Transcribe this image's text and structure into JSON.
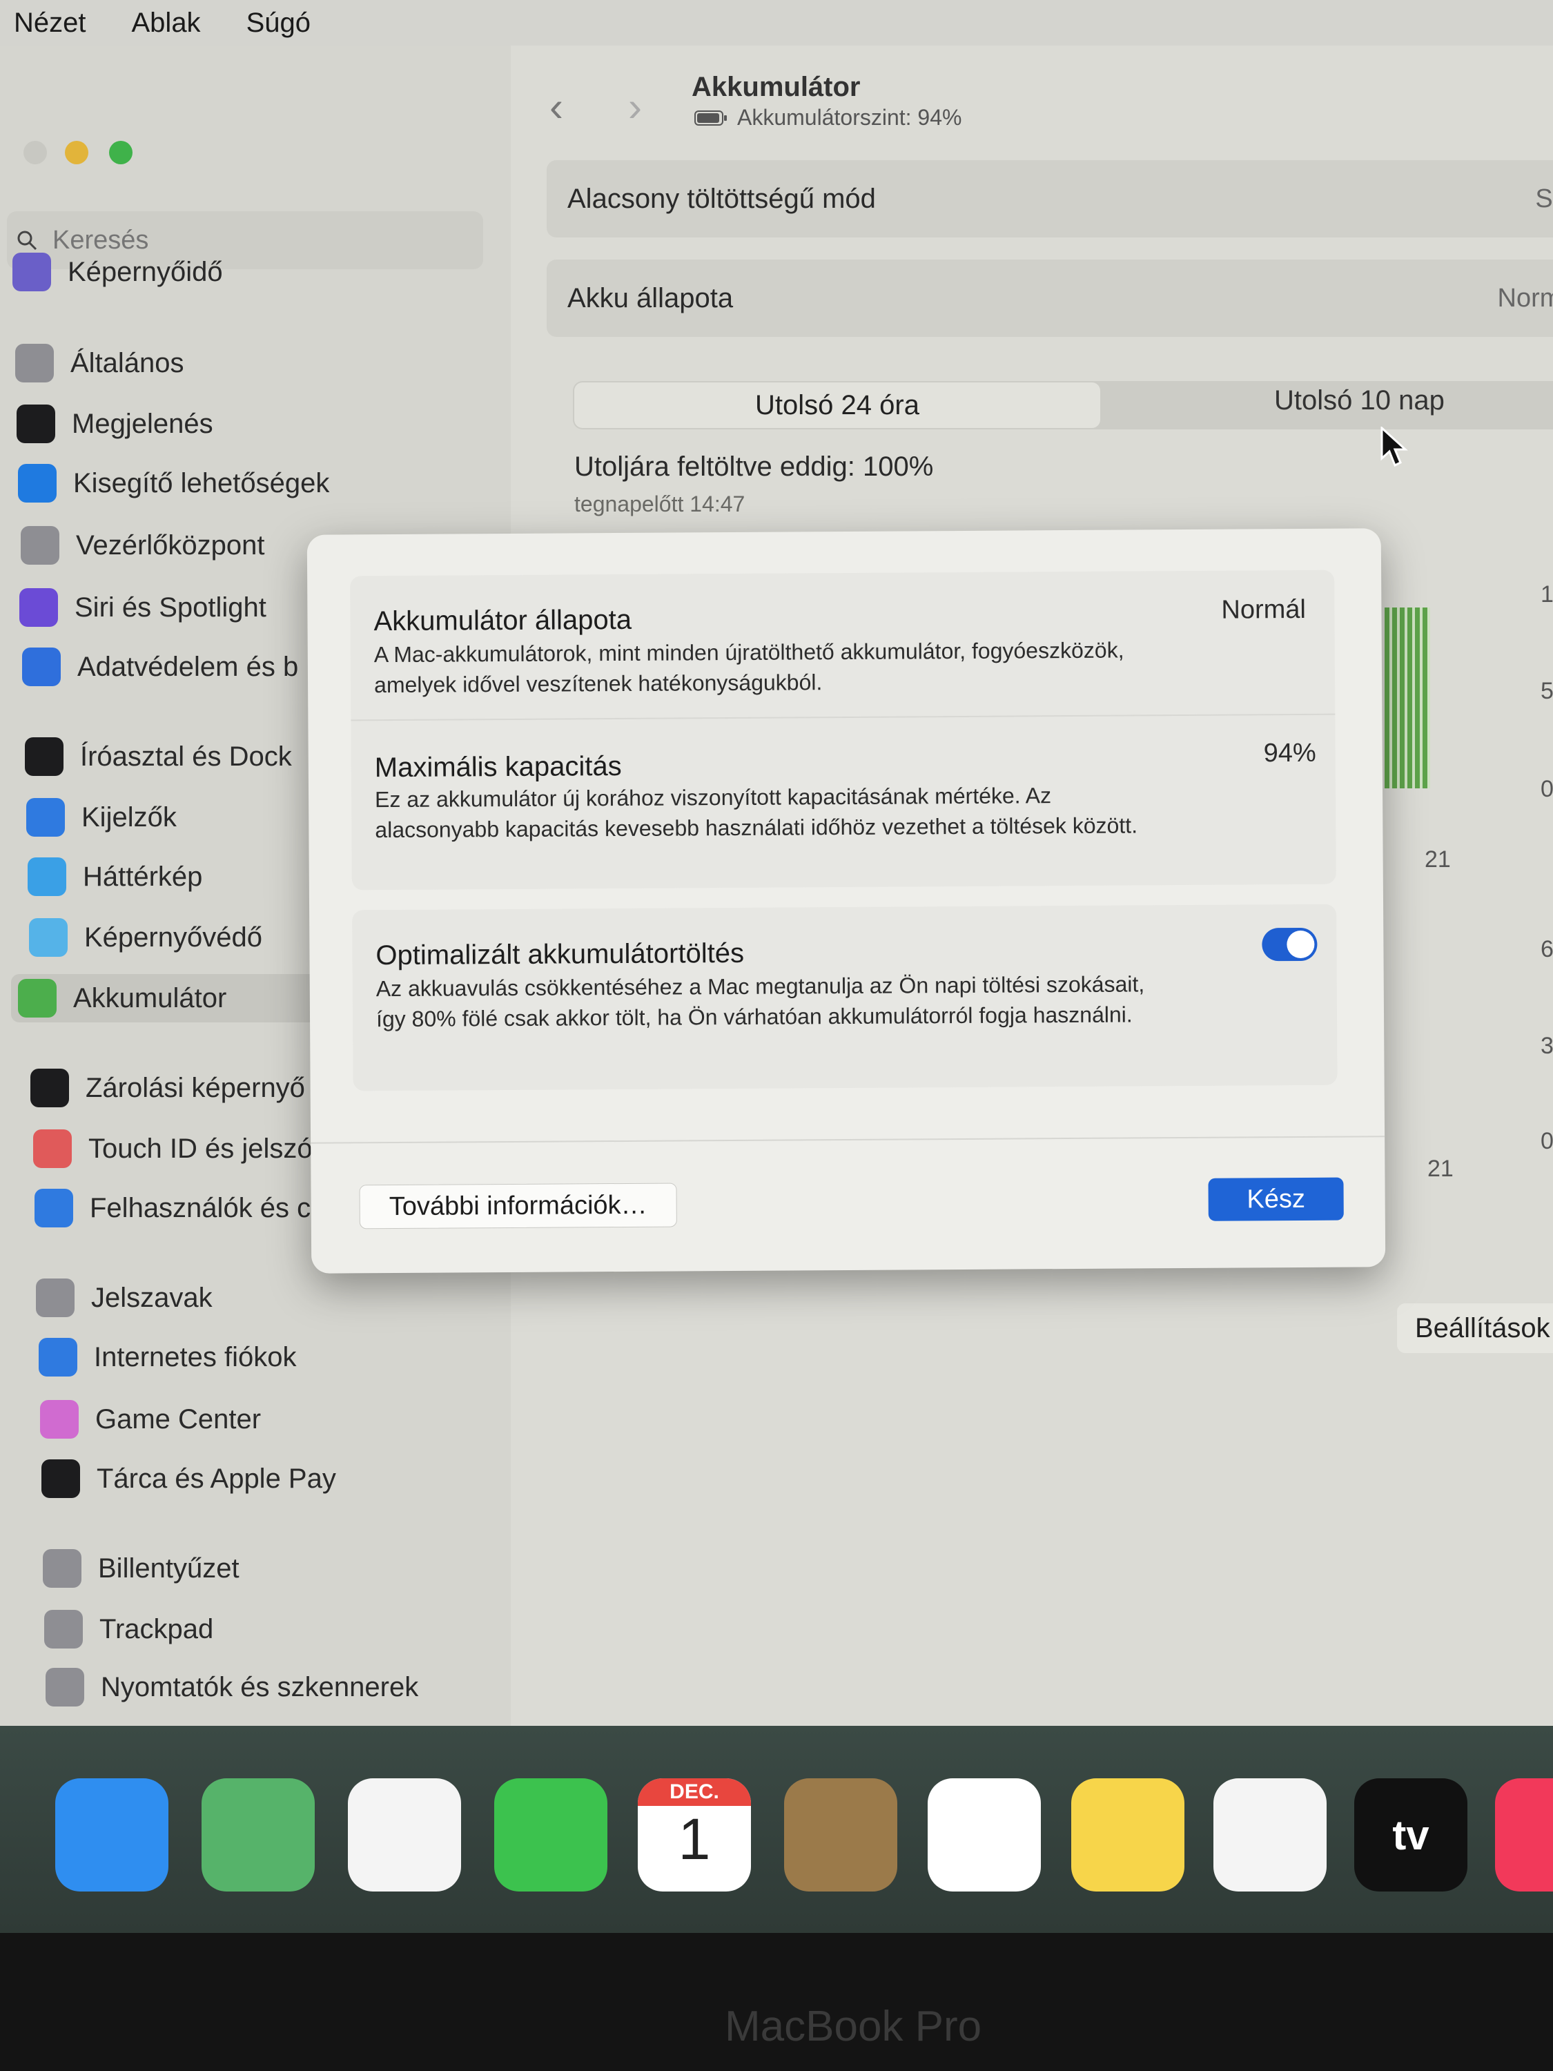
{
  "menubar": {
    "items": [
      "Nézet",
      "Ablak",
      "Súgó"
    ]
  },
  "window": {
    "search_placeholder": "Keresés",
    "sidebar": [
      {
        "label": "Képernyőidő",
        "icon": "hourglass-icon",
        "color": "#6a5fc8"
      },
      {
        "label": "Általános",
        "icon": "gear-icon",
        "color": "#8e8e93"
      },
      {
        "label": "Megjelenés",
        "icon": "appearance-icon",
        "color": "#1c1c1e"
      },
      {
        "label": "Kisegítő lehetőségek",
        "icon": "accessibility-icon",
        "color": "#1f7ae0"
      },
      {
        "label": "Vezérlőközpont",
        "icon": "control-center-icon",
        "color": "#8e8e93"
      },
      {
        "label": "Siri és Spotlight",
        "icon": "siri-icon",
        "color": "#6b4bd6"
      },
      {
        "label": "Adatvédelem és b",
        "icon": "hand-icon",
        "color": "#2f6fdc"
      },
      {
        "label": "Íróasztal és Dock",
        "icon": "dock-icon",
        "color": "#1c1c1e"
      },
      {
        "label": "Kijelzők",
        "icon": "display-icon",
        "color": "#2f7ae0"
      },
      {
        "label": "Háttérkép",
        "icon": "wallpaper-icon",
        "color": "#3aa0e6"
      },
      {
        "label": "Képernyővédő",
        "icon": "screensaver-icon",
        "color": "#55b3e8"
      },
      {
        "label": "Akkumulátor",
        "icon": "battery-icon",
        "color": "#4cae4c"
      },
      {
        "label": "Zárolási képernyő",
        "icon": "lock-icon",
        "color": "#1c1c1e"
      },
      {
        "label": "Touch ID és jelszó",
        "icon": "fingerprint-icon",
        "color": "#e05a5a"
      },
      {
        "label": "Felhasználók és c",
        "icon": "users-icon",
        "color": "#2f7ae0"
      },
      {
        "label": "Jelszavak",
        "icon": "key-icon",
        "color": "#8e8e93"
      },
      {
        "label": "Internetes fiókok",
        "icon": "at-icon",
        "color": "#2f7ae0"
      },
      {
        "label": "Game Center",
        "icon": "game-center-icon",
        "color": "#d06bd0"
      },
      {
        "label": "Tárca és Apple Pay",
        "icon": "wallet-icon",
        "color": "#1c1c1e"
      },
      {
        "label": "Billentyűzet",
        "icon": "keyboard-icon",
        "color": "#8e8e93"
      },
      {
        "label": "Trackpad",
        "icon": "trackpad-icon",
        "color": "#8e8e93"
      },
      {
        "label": "Nyomtatók és szkennerek",
        "icon": "printer-icon",
        "color": "#8e8e93"
      }
    ],
    "header": {
      "title": "Akkumulátor",
      "subtitle": "Akkumulátorszint: 94%"
    },
    "rows": [
      {
        "label": "Alacsony töltöttségű mód",
        "value": "Soh"
      },
      {
        "label": "Akku állapota",
        "value": "Normál"
      }
    ],
    "tabs": [
      "Utolsó 24 óra",
      "Utolsó 10 nap"
    ],
    "last_charged": "Utoljára feltöltve eddig: 100%",
    "last_charged_time": "tegnapelőtt 14:47",
    "axis": {
      "a": "1",
      "b": "5",
      "c": "0",
      "d": "21",
      "e": "6",
      "f": "3",
      "g": "0",
      "h": "21"
    },
    "settings_button": "Beállítások"
  },
  "modal": {
    "health_title": "Akkumulátor állapota",
    "health_value": "Normál",
    "health_text": "A Mac-akkumulátorok, mint minden újratölthető akkumulátor, fogyóeszközök, amelyek idővel veszítenek hatékonyságukból.",
    "capacity_title": "Maximális kapacitás",
    "capacity_value": "94%",
    "capacity_text": "Ez az akkumulátor új korához viszonyított kapacitásának mértéke. Az alacsonyabb kapacitás kevesebb használati időhöz vezethet a töltések között.",
    "optimized_title": "Optimalizált akkumulátortöltés",
    "optimized_text": "Az akkuavulás csökkentéséhez a Mac megtanulja az Ön napi töltési szokásait, így 80% fölé csak akkor tölt, ha Ön várhatóan akkumulátorról fogja használni.",
    "optimized_on": true,
    "more_button": "További információk…",
    "done_button": "Kész"
  },
  "dock": {
    "apps": [
      {
        "name": "mail-icon",
        "color": "#2f8ef0"
      },
      {
        "name": "maps-icon",
        "color": "#56b36a"
      },
      {
        "name": "photos-icon",
        "color": "#f4f4f4"
      },
      {
        "name": "facetime-icon",
        "color": "#3cc24e"
      },
      {
        "name": "calendar-icon",
        "color": "#ffffff"
      },
      {
        "name": "contacts-icon",
        "color": "#9b7a4a"
      },
      {
        "name": "reminders-icon",
        "color": "#ffffff"
      },
      {
        "name": "notes-icon",
        "color": "#f7d54a"
      },
      {
        "name": "freeform-icon",
        "color": "#f4f4f4"
      },
      {
        "name": "tv-icon",
        "color": "#111111"
      },
      {
        "name": "music-icon",
        "color": "#f2395a"
      }
    ],
    "calendar_month": "DEC.",
    "calendar_day": "1",
    "tv_label": "tv"
  },
  "brand": "MacBook Pro"
}
